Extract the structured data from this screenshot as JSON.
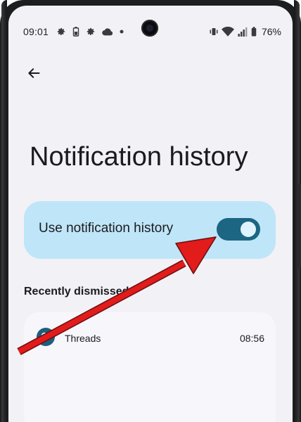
{
  "status_bar": {
    "time": "09:01",
    "battery_percent": "76%",
    "icons_left": [
      "gear-icon",
      "battery-saver-icon",
      "gear-icon",
      "cloud-icon",
      "dot-icon"
    ],
    "icons_right": [
      "vibrate-icon",
      "wifi-icon",
      "signal-icon",
      "battery-icon"
    ]
  },
  "header": {
    "back_icon": "arrow-left-icon",
    "title": "Notification history"
  },
  "toggle": {
    "label": "Use notification history",
    "checked": true,
    "color_track": "#1c6583",
    "color_card": "#bfe5f8"
  },
  "recent": {
    "heading": "Recently dismissed",
    "items": [
      {
        "app": "Threads",
        "time": "08:56",
        "icon": "threads-icon"
      }
    ]
  },
  "annotation": {
    "arrow_color": "#e21b1b"
  }
}
